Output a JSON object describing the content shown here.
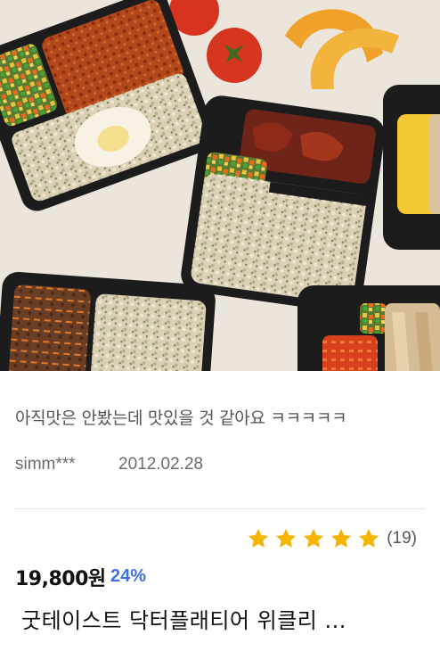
{
  "review": {
    "text": "아직맛은 안봤는데 맛있을 것 같아요 ㅋㅋㅋㅋㅋ",
    "reviewer": "simm***",
    "date": "2012.02.28"
  },
  "rating": {
    "stars": 5,
    "max_stars": 5,
    "count_label": "(19)",
    "star_color": "#f5b400"
  },
  "product": {
    "price": "19,800원",
    "discount": "24%",
    "discount_color": "#3a72e3",
    "name": "굿테이스트 닥터플래티어 위클리 ..."
  },
  "image": {
    "subject": "meal-prep-lunchbox-photo"
  }
}
